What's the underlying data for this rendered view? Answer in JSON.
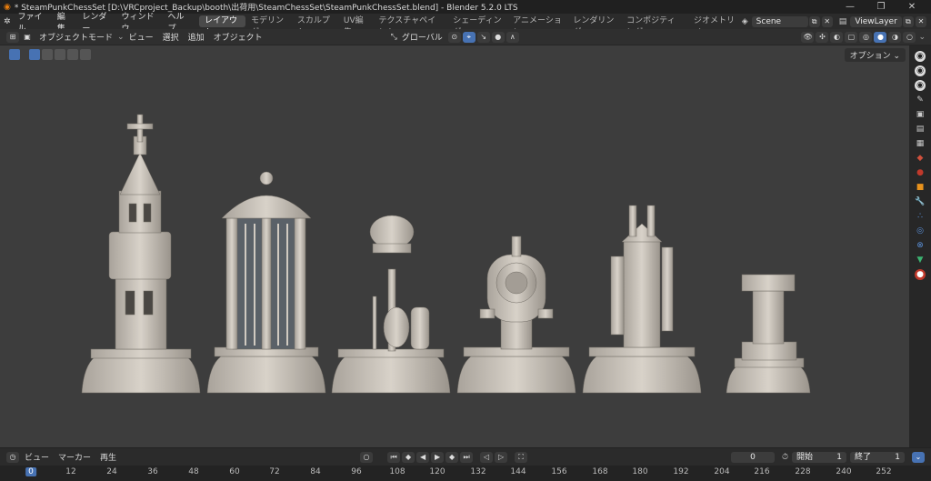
{
  "titlebar": {
    "title": "* SteamPunkChessSet [D:\\VRCproject_Backup\\booth\\出荷用\\SteamChessSet\\SteamPunkChessSet.blend] - Blender 5.2.0 LTS",
    "min": "—",
    "max": "❐",
    "close": "✕"
  },
  "topbar": {
    "menus": [
      "ファイル",
      "編集",
      "レンダー",
      "ウィンドウ",
      "ヘルプ"
    ],
    "workspaces": [
      "レイアウト",
      "モデリング",
      "スカルプト",
      "UV編集",
      "テクスチャペイント",
      "シェーディング",
      "アニメーション",
      "レンダリング",
      "コンポジティング",
      "ジオメトリノ"
    ],
    "active_workspace": "レイアウト",
    "scene": "Scene",
    "view_layer": "ViewLayer"
  },
  "header": {
    "mode": "オブジェクトモード",
    "view": "ビュー",
    "select": "選択",
    "add": "追加",
    "object": "オブジェクト",
    "orientation": "グローバル"
  },
  "viewport": {
    "options": "オプション"
  },
  "timeline": {
    "view": "ビュー",
    "marker": "マーカー",
    "playback": "再生",
    "current_frame": "0",
    "start_label": "開始",
    "start": "1",
    "end_label": "終了",
    "end": "1"
  },
  "ruler": {
    "ticks": [
      "0",
      "12",
      "24",
      "36",
      "48",
      "60",
      "72",
      "84",
      "96",
      "108",
      "120",
      "132",
      "144",
      "156",
      "168",
      "180",
      "192",
      "204",
      "216",
      "228",
      "240",
      "252"
    ]
  },
  "colors": {
    "accent": "#4772b3",
    "model": "#cfc9c0",
    "viewport_bg": "#3d3d3d"
  }
}
